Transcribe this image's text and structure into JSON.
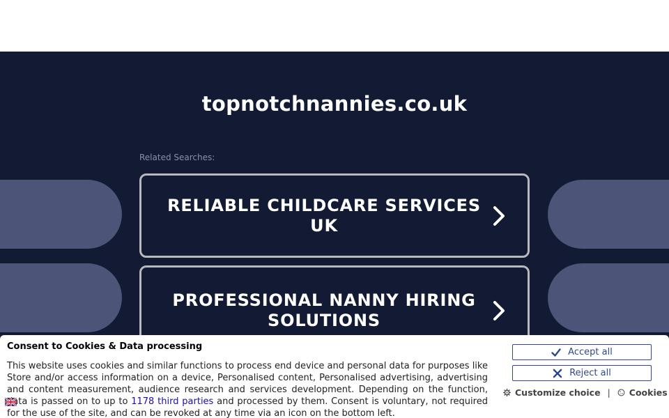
{
  "page": {
    "domain": "topnotchnannies.co.uk",
    "related_label": "Related Searches:",
    "search_links": [
      {
        "label": "RELIABLE CHILDCARE SERVICES UK"
      },
      {
        "label": "PROFESSIONAL NANNY HIRING SOLUTIONS"
      }
    ]
  },
  "consent": {
    "title": "Consent to Cookies & Data processing",
    "text_before": "This website uses cookies and similar functions to process end device and personal data for purposes like Store and/or access information on a device, Personalised content, Personalised advertising, advertising and content measurement, audience research and services development. Depending on the function, data is passed on to up to ",
    "third_parties_link": "1178 third parties",
    "text_after": " and processed by them. Consent is voluntary, not required for the use of the site, and can be revoked at any time via an icon on the bottom left.",
    "accept_label": "Accept all",
    "reject_label": "Reject all",
    "customize_label": "Customize choice",
    "separator": "|",
    "cookies_label": "Cookies"
  },
  "colors": {
    "dark_bg": "#131a33",
    "deco": "#4c5478",
    "button_accent": "#2f4a8a",
    "link": "#1a0dab"
  },
  "icons": {
    "chevron": "chevron-right-icon",
    "accept": "check-icon",
    "reject": "x-icon",
    "customize": "gear-icon",
    "cookies": "cookie-icon",
    "flag": "uk-flag-icon"
  }
}
